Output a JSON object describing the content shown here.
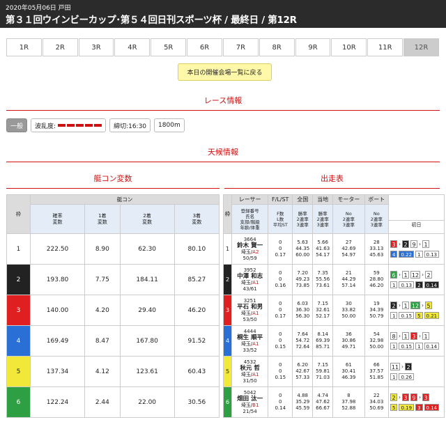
{
  "header": {
    "date": "2020年05月06日 戸田",
    "title": "第３１回ウインビーカップ･第５４回日刊スポーツ杯 / 最終日 / 第12R"
  },
  "tabs": [
    "1R",
    "2R",
    "3R",
    "4R",
    "5R",
    "6R",
    "7R",
    "8R",
    "9R",
    "10R",
    "11R",
    "12R"
  ],
  "active_tab": "12R",
  "back_button": "本日の開催会場一覧に戻る",
  "race_info": {
    "heading": "レース情報",
    "grade": "一般",
    "wave_label": "波乱度:",
    "deadline": "締切:16:30",
    "distance": "1800m"
  },
  "weather_heading": "天候情報",
  "motor_heading": "艇コン変数",
  "entry_heading": "出走表",
  "left_table": {
    "col_waku": "枠",
    "group": "艇コン",
    "cols": [
      "確率\n変数",
      "1着\n変数",
      "2着\n変数",
      "3着\n変数"
    ],
    "rows": [
      {
        "waku": "1",
        "vals": [
          "222.50",
          "8.90",
          "62.30",
          "80.10"
        ]
      },
      {
        "waku": "2",
        "vals": [
          "193.80",
          "7.75",
          "184.11",
          "85.27"
        ]
      },
      {
        "waku": "3",
        "vals": [
          "140.00",
          "4.20",
          "29.40",
          "46.20"
        ]
      },
      {
        "waku": "4",
        "vals": [
          "169.49",
          "8.47",
          "167.80",
          "91.52"
        ]
      },
      {
        "waku": "5",
        "vals": [
          "137.34",
          "4.12",
          "123.61",
          "60.43"
        ]
      },
      {
        "waku": "6",
        "vals": [
          "122.24",
          "2.44",
          "22.00",
          "30.56"
        ]
      }
    ]
  },
  "right_table": {
    "col_waku": "枠",
    "headers": [
      "レーサー",
      "F/L/ST",
      "全国",
      "当地",
      "モーター",
      "ボート"
    ],
    "sub": [
      "登録番号\n氏名\n支部/階級\n年齢/体重",
      "F数\nL数\n平均ST",
      "勝率\n2連率\n3連率",
      "勝率\n2連率\n3連率",
      "No\n2連率\n3連率",
      "No\n2連率\n3連率"
    ],
    "first_day": "初日",
    "rows": [
      {
        "waku": "1",
        "reg": "3664",
        "name": "鈴木 賢一",
        "branch": "埼玉/A2",
        "age": "50/59",
        "fl": "0\n0\n0.17",
        "zen": "5.63\n44.35\n60.00",
        "toc": "5.66\n41.63\n54.17",
        "mot": "27\n42.69\n54.97",
        "boat": "28\n33.13\n45.63",
        "r1": [
          [
            "3",
            "c3"
          ],
          [
            "2",
            "c2"
          ]
        ],
        "r1b": [
          [
            "4",
            "c4"
          ],
          "0.22"
        ],
        "r2": [
          [
            "9",
            "c1"
          ],
          [
            "1",
            "c1"
          ]
        ],
        "r2b": [
          [
            "1",
            "c1"
          ],
          "0.13"
        ]
      },
      {
        "waku": "2",
        "reg": "3952",
        "name": "中澤 和志",
        "branch": "埼玉/A1",
        "age": "43/61",
        "fl": "0\n0\n0.16",
        "zen": "7.20\n49.23\n73.85",
        "toc": "7.35\n55.56\n73.61",
        "mot": "21\n44.29\n57.14",
        "boat": "59\n28.80\n46.20",
        "r1": [
          [
            "6",
            "c6"
          ],
          [
            "1",
            "c1"
          ]
        ],
        "r1b": [
          [
            "1",
            "c1"
          ],
          "0.13"
        ],
        "r2": [
          [
            "12",
            "c1"
          ],
          [
            "2",
            "c1"
          ]
        ],
        "r2b": [
          [
            "2",
            "c2"
          ],
          "0.14"
        ]
      },
      {
        "waku": "3",
        "reg": "3251",
        "name": "平石 和男",
        "branch": "埼玉/A1",
        "age": "53/50",
        "fl": "0\n0\n0.17",
        "zen": "6.03\n36.30\n56.30",
        "toc": "7.15\n32.61\n52.17",
        "mot": "30\n33.82\n50.00",
        "boat": "19\n34.39\n50.79",
        "r1": [
          [
            "2",
            "c2"
          ],
          [
            "1",
            "c1"
          ]
        ],
        "r1b": [
          [
            "1",
            "c1"
          ],
          "0.15"
        ],
        "r2": [
          [
            "12",
            "c6"
          ],
          [
            "5",
            "c5"
          ]
        ],
        "r2b": [
          [
            "5",
            "c5"
          ],
          "0.21"
        ]
      },
      {
        "waku": "4",
        "reg": "4444",
        "name": "桐生 順平",
        "branch": "埼玉/A1",
        "age": "33/52",
        "fl": "0\n0\n0.15",
        "zen": "7.64\n54.72\n72.64",
        "toc": "8.14\n69.39\n85.71",
        "mot": "36\n30.86\n49.71",
        "boat": "54\n32.98\n50.00",
        "r1": [
          [
            "8",
            "c1"
          ],
          [
            "1",
            "c1"
          ]
        ],
        "r1b": [
          [
            "1",
            "c1"
          ],
          "0.15"
        ],
        "r2": [
          [
            "3",
            "c3"
          ],
          [
            "1",
            "c1"
          ]
        ],
        "r2b": [
          [
            "1",
            "c1"
          ],
          "0.14"
        ]
      },
      {
        "waku": "5",
        "reg": "4532",
        "name": "秋元 哲",
        "branch": "埼玉/A1",
        "age": "31/50",
        "fl": "0\n0\n0.15",
        "zen": "6.20\n42.67\n57.33",
        "toc": "7.15\n59.81\n71.03",
        "mot": "61\n30.41\n46.39",
        "boat": "66\n37.57\n51.85",
        "r1": [
          [
            "11",
            "c1"
          ],
          [
            "2",
            "c2"
          ]
        ],
        "r1b": [
          [
            "1",
            "c1"
          ],
          "0.26"
        ],
        "r2": [],
        "r2b": []
      },
      {
        "waku": "6",
        "reg": "5042",
        "name": "畑田 汰一",
        "branch": "埼玉/B1",
        "age": "21/54",
        "fl": "0\n0\n0.14",
        "zen": "4.88\n35.29\n45.59",
        "toc": "4.74\n47.62\n66.67",
        "mot": "8\n37.98\n52.88",
        "boat": "22\n34.03\n50.69",
        "r1": [
          [
            "2",
            "c5"
          ],
          [
            "3",
            "c3"
          ]
        ],
        "r1b": [
          [
            "5",
            "c5"
          ],
          "0.19"
        ],
        "r2": [
          [
            "9",
            "c3"
          ],
          [
            "3",
            "c3"
          ]
        ],
        "r2b": [
          [
            "3",
            "c3"
          ],
          "0.14"
        ]
      }
    ]
  },
  "colors": {
    "w1": "#ffffff",
    "w2": "#222222",
    "w3": "#e02020",
    "w4": "#2a6fd6",
    "w5": "#f2e83a",
    "w6": "#2ea043",
    "accent": "#d01010"
  }
}
